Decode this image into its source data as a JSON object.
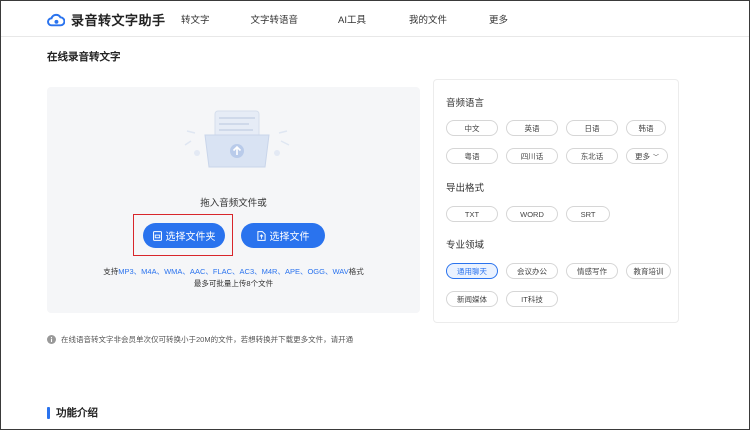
{
  "app": {
    "title": "录音转文字助手"
  },
  "nav": {
    "items": [
      {
        "label": "转文字"
      },
      {
        "label": "文字转语音"
      },
      {
        "label": "AI工具"
      },
      {
        "label": "我的文件"
      },
      {
        "label": "更多"
      }
    ]
  },
  "page": {
    "title": "在线录音转文字"
  },
  "upload": {
    "drag_text": "拖入音频文件或",
    "folder_button": "选择文件夹",
    "file_button": "选择文件",
    "formats_prefix": "支持",
    "formats_list": "MP3、M4A、WMA、AAC、FLAC、AC3、M4R、APE、OGG、WAV",
    "formats_suffix": "格式",
    "limit_text": "最多可批量上传8个文件"
  },
  "options": {
    "language": {
      "title": "音频语言",
      "items": [
        "中文",
        "英语",
        "日语",
        "韩语",
        "粤语",
        "四川话",
        "东北话",
        "更多"
      ]
    },
    "export": {
      "title": "导出格式",
      "items": [
        "TXT",
        "WORD",
        "SRT"
      ]
    },
    "domain": {
      "title": "专业领域",
      "items": [
        "通用聊天",
        "会议办公",
        "情感写作",
        "教育培训",
        "新闻媒体",
        "IT科技"
      ],
      "selected": "通用聊天"
    }
  },
  "notice": {
    "text": "在线语音转文字非会员单次仅可转换小于20M的文件，若想转换并下载更多文件，请开通"
  },
  "section": {
    "title": "功能介绍"
  },
  "colors": {
    "accent": "#2a73ee",
    "highlight": "#d8262b"
  }
}
